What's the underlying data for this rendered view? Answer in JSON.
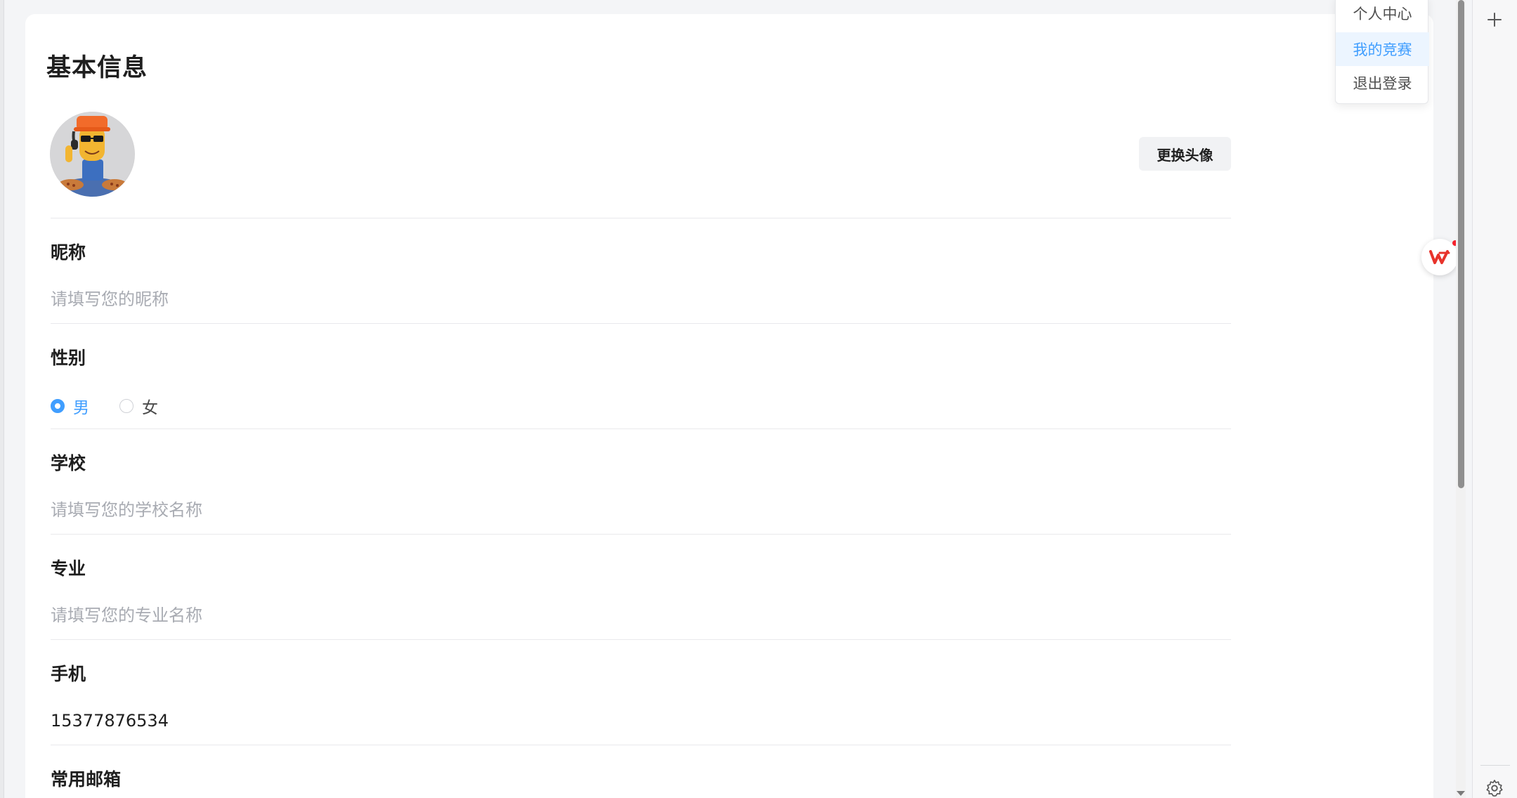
{
  "colors": {
    "accent": "#409eff",
    "placeholder": "#a8abb2",
    "active_bg": "#ecf5ff",
    "badge_red": "#f5222d"
  },
  "card": {
    "title": "基本信息",
    "change_avatar_label": "更换头像"
  },
  "fields": {
    "nickname": {
      "label": "昵称",
      "placeholder": "请填写您的昵称",
      "value": ""
    },
    "gender": {
      "label": "性别",
      "options": [
        {
          "label": "男",
          "checked": true
        },
        {
          "label": "女",
          "checked": false
        }
      ]
    },
    "school": {
      "label": "学校",
      "placeholder": "请填写您的学校名称",
      "value": ""
    },
    "major": {
      "label": "专业",
      "placeholder": "请填写您的专业名称",
      "value": ""
    },
    "phone": {
      "label": "手机",
      "value": "15377876534"
    },
    "email": {
      "label": "常用邮箱"
    }
  },
  "dropdown": {
    "items": [
      {
        "label": "个人中心",
        "active": false
      },
      {
        "label": "我的竞赛",
        "active": true
      },
      {
        "label": "退出登录",
        "active": false
      }
    ]
  },
  "icons": {
    "float_badge": "wps-logo-icon",
    "side_top": "plus-icon",
    "side_bottom": "gear-icon"
  }
}
